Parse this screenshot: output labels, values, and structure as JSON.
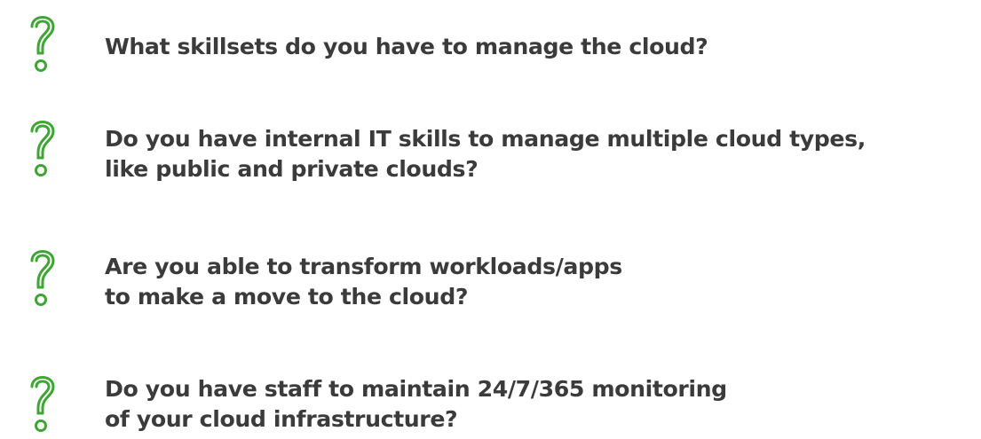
{
  "colors": {
    "icon": "#3fa535",
    "text": "#3b3b3b",
    "background": "#ffffff"
  },
  "items": [
    {
      "icon": "question-mark-icon",
      "lines": [
        "What skillsets do you have to manage the cloud?"
      ]
    },
    {
      "icon": "question-mark-icon",
      "lines": [
        "Do you have internal IT skills to manage multiple cloud types,",
        "like public and private clouds?"
      ]
    },
    {
      "icon": "question-mark-icon",
      "lines": [
        "Are you able to transform workloads/apps",
        "to make a move to the cloud?"
      ]
    },
    {
      "icon": "question-mark-icon",
      "lines": [
        "Do you have staff to maintain 24/7/365 monitoring",
        "of your cloud infrastructure?"
      ]
    }
  ]
}
